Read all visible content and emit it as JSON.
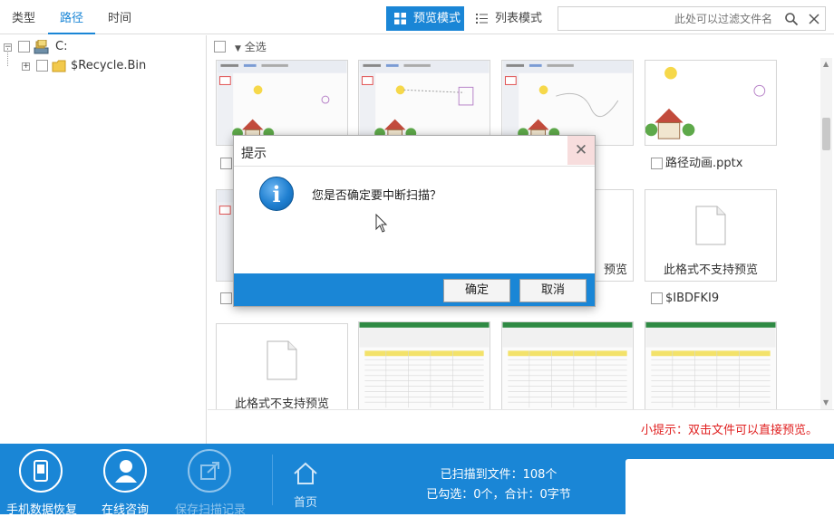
{
  "topbar": {
    "tabs": [
      {
        "label": "类型",
        "active": false
      },
      {
        "label": "路径",
        "active": true
      },
      {
        "label": "时间",
        "active": false
      }
    ],
    "preview_mode_label": "预览模式",
    "list_mode_label": "列表模式",
    "search_placeholder": "此处可以过滤文件名",
    "accent_color": "#1a86d6"
  },
  "tree": {
    "items": [
      {
        "label": "C:",
        "icon": "drive-icon"
      },
      {
        "label": "$Recycle.Bin",
        "icon": "folder-icon"
      }
    ]
  },
  "main": {
    "select_all_label": "全选",
    "files": [
      {
        "name": "",
        "kind": "ppt-slide"
      },
      {
        "name": "",
        "kind": "ppt-slide"
      },
      {
        "name": "",
        "kind": "ppt-slide"
      },
      {
        "name": "路径动画.pptx",
        "kind": "ppt-slide"
      },
      {
        "name": "",
        "kind": "ppt-slide"
      },
      {
        "name": "",
        "kind": "no-preview",
        "partial_label": "预览"
      },
      {
        "name": "$IBDFKI9",
        "kind": "no-preview"
      },
      {
        "name": "",
        "kind": "no-preview"
      },
      {
        "name": "",
        "kind": "spreadsheet"
      },
      {
        "name": "",
        "kind": "spreadsheet"
      },
      {
        "name": "",
        "kind": "spreadsheet"
      }
    ],
    "no_preview_label": "此格式不支持预览",
    "tip": "小提示：双击文件可以直接预览。"
  },
  "bottombar": {
    "buttons": [
      {
        "label": "手机数据恢复",
        "icon": "phone-icon",
        "enabled": true
      },
      {
        "label": "在线咨询",
        "icon": "user-icon",
        "enabled": true
      },
      {
        "label": "保存扫描记录",
        "icon": "export-icon",
        "enabled": false
      }
    ],
    "home_label": "首页",
    "scanned_line": "已扫描到文件：108个",
    "selected_line": "已勾选：0个，合计：0字节"
  },
  "dialog": {
    "title": "提示",
    "message": "您是否确定要中断扫描？",
    "ok_label": "确定",
    "cancel_label": "取消"
  }
}
